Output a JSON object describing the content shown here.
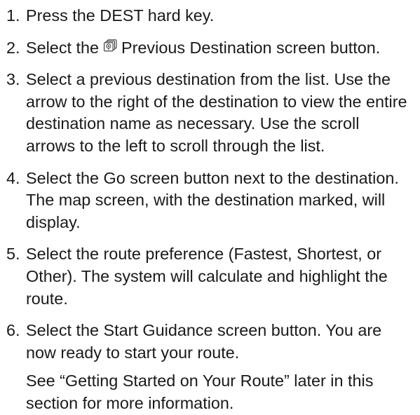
{
  "steps": [
    {
      "num": "1.",
      "text": "Press the DEST hard key."
    },
    {
      "num": "2.",
      "text_before": "Select the ",
      "icon": "previous-destination-icon",
      "text_after": " Previous Destination screen button."
    },
    {
      "num": "3.",
      "text": "Select a previous destination from the list. Use the arrow to the right of the destination to view the entire destination name as necessary. Use the scroll arrows to the left to scroll through the list."
    },
    {
      "num": "4.",
      "text": "Select the Go screen button next to the destination. The map screen, with the destination marked, will display."
    },
    {
      "num": "5.",
      "text": "Select the route preference (Fastest, Shortest, or Other). The system will calculate and highlight the route."
    },
    {
      "num": "6.",
      "text": "Select the Start Guidance screen button. You are now ready to start your route."
    }
  ],
  "note": "See “Getting Started on Your Route” later in this section for more information."
}
